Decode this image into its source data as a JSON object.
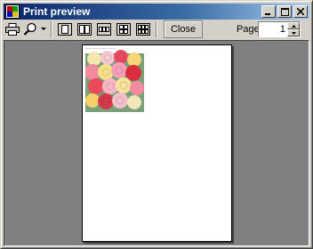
{
  "window": {
    "title": "Print preview",
    "caption_buttons": [
      "minimize",
      "maximize",
      "close"
    ]
  },
  "toolbar": {
    "print_icon": "printer-icon",
    "zoom_icon": "magnifier-icon",
    "zoom_dropdown_icon": "dropdown-arrow-icon",
    "page_layouts": [
      "one-page",
      "two-pages",
      "three-pages",
      "four-pages",
      "six-pages"
    ],
    "close_label": "Close",
    "page_label": "Page",
    "page_value": "1"
  },
  "preview": {
    "image_caption": "~~~ ~~~ ~~~~ ~~~",
    "image_subject": "rose bouquet photo"
  },
  "colors": {
    "titlebar_start": "#0a246a",
    "titlebar_end": "#a6caf0",
    "face": "#d4d0c8",
    "preview_bg": "#808080",
    "page": "#ffffff"
  }
}
